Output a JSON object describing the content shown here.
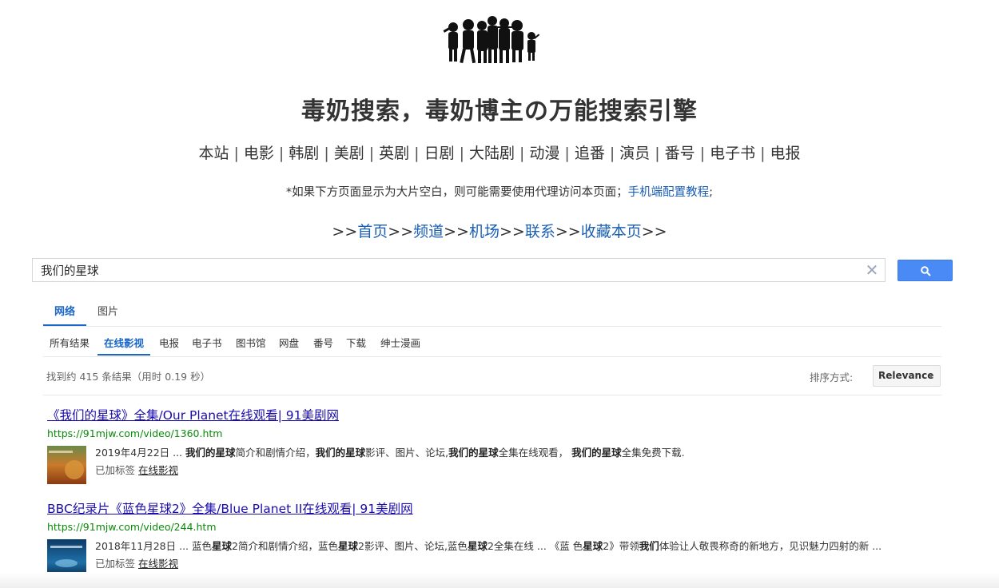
{
  "site": {
    "title": "毒奶搜索，毒奶博主の万能搜索引擎",
    "logo_icon": "children-silhouette-logo"
  },
  "nav": {
    "items": [
      "本站",
      "电影",
      "韩剧",
      "美剧",
      "英剧",
      "日剧",
      "大陆剧",
      "动漫",
      "追番",
      "演员",
      "番号",
      "电子书",
      "电报"
    ],
    "separator": "|"
  },
  "notice": {
    "text": "*如果下方页面显示为大片空白，则可能需要使用代理访问本页面；",
    "link": "手机端配置教程",
    "suffix": ";"
  },
  "links": {
    "prefix": ">>",
    "items": [
      "首页",
      "频道",
      "机场",
      "联系",
      "收藏本页"
    ],
    "sep": ">>"
  },
  "search": {
    "value": "我们的星球",
    "clear_icon": "close-icon",
    "button_icon": "search-icon",
    "button_color": "#4a8af4"
  },
  "tabs": {
    "main": [
      "网络",
      "图片"
    ],
    "active_main": "网络",
    "sub": [
      "所有结果",
      "在线影视",
      "电报",
      "电子书",
      "图书馆",
      "网盘",
      "番号",
      "下载",
      "绅士漫画"
    ],
    "active_sub": "在线影视"
  },
  "results_info": {
    "count_text": "找到约 415 条结果（用时 0.19 秒）",
    "sort_label": "排序方式:",
    "sort_value": "Relevance"
  },
  "results": [
    {
      "title": "《我们的星球》全集/Our Planet在线观看| 91美剧网",
      "url": "https://91mjw.com/video/1360.htm",
      "date": "2019年4月22日",
      "snippet_parts": [
        " ... ",
        "我们的星球",
        "简介和剧情介绍，",
        "我们的星球",
        "影评、图片、论坛,",
        "我们的星球",
        "全集在线观看， ",
        "我们的星球",
        "全集免费下载."
      ],
      "tag_label": "已加标签",
      "tag": "在线影视"
    },
    {
      "title": "BBC纪录片《蓝色星球2》全集/Blue Planet II在线观看| 91美剧网",
      "url": "https://91mjw.com/video/244.htm",
      "date": "2018年11月28日",
      "snippet_parts": [
        " ... 蓝色",
        "星球",
        "2简介和剧情介绍，蓝色",
        "星球",
        "2影评、图片、论坛,蓝色",
        "星球",
        "2全集在线 ... 《蓝 色",
        "星球",
        "2》带领",
        "我们",
        "体验让人敬畏称奇的新地方，见识魅力四射的新 ..."
      ],
      "tag_label": "已加标签",
      "tag": "在线影视"
    }
  ],
  "colors": {
    "link_blue": "#1a5fb4",
    "tab_active": "#1a66c9",
    "result_title": "#1a0dab",
    "url_green": "#0a8a0a"
  }
}
